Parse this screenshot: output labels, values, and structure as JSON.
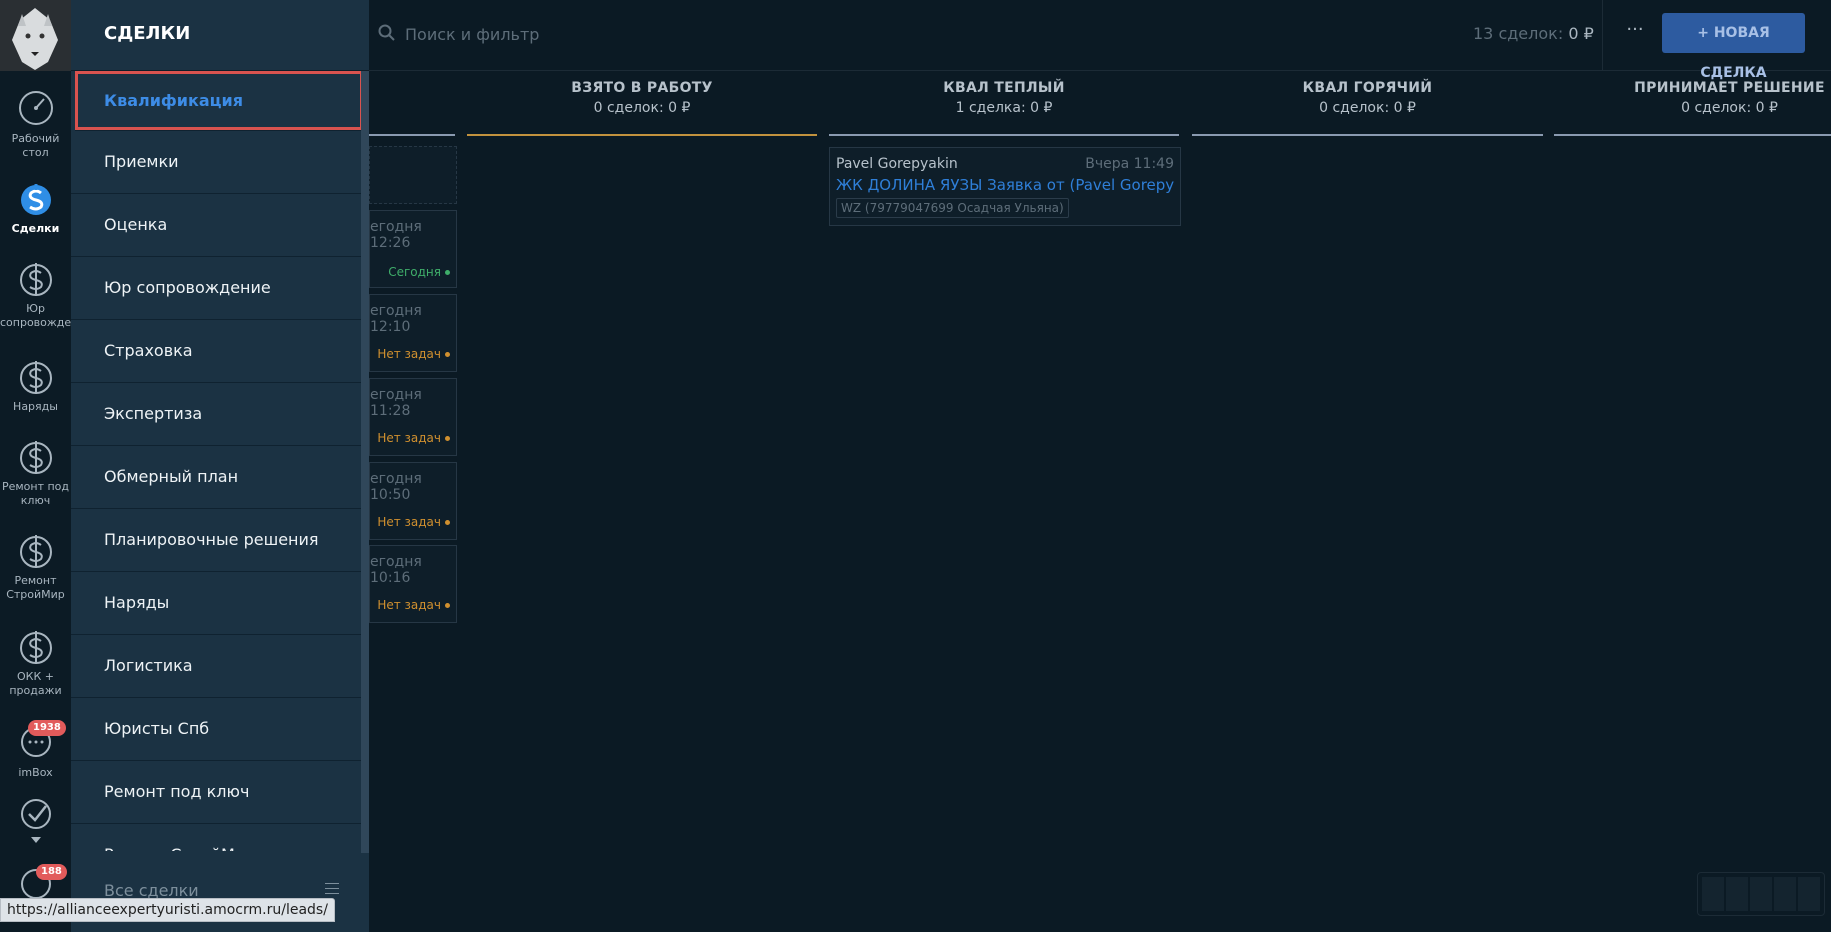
{
  "nav": {
    "items": [
      {
        "label": "Рабочий стол",
        "icon": "dashboard-gauge-icon"
      },
      {
        "label": "Сделки",
        "icon": "deals-dollar-icon"
      },
      {
        "label": "Юр сопровожде",
        "icon": "dollar-icon"
      },
      {
        "label": "Наряды",
        "icon": "dollar-icon"
      },
      {
        "label": "Ремонт под ключ",
        "icon": "dollar-icon"
      },
      {
        "label": "Ремонт СтройМир",
        "icon": "dollar-icon"
      },
      {
        "label": "ОКК + продажи",
        "icon": "dollar-icon"
      },
      {
        "label": "imBox",
        "icon": "chat-icon",
        "badge": "1938"
      },
      {
        "label": "",
        "icon": "checkmark-icon"
      }
    ],
    "bottom_badge": "188"
  },
  "pipelines": {
    "title": "СДЕЛКИ",
    "items": [
      "Квалификация",
      "Приемки",
      "Оценка",
      "Юр сопровождение",
      "Страховка",
      "Экспертиза",
      "Обмерный план",
      "Планировочные решения",
      "Наряды",
      "Логистика",
      "Юристы Спб",
      "Ремонт под ключ",
      "Ремонт СтройМир"
    ],
    "active_index": 0,
    "all_deals": "Все сделки"
  },
  "topbar": {
    "search_placeholder": "Поиск и фильтр",
    "count_label": "13 сделок:",
    "count_value": "0 ₽",
    "more": "···",
    "new_deal": "+ НОВАЯ СДЕЛКА"
  },
  "columns": [
    {
      "title": "ВЗЯТО В РАБОТУ",
      "count": "0 сделок: 0 ₽",
      "color": "#c2923e"
    },
    {
      "title": "КВАЛ ТЕПЛЫЙ",
      "count": "1 сделка: 0 ₽",
      "color": "#8a9ab0"
    },
    {
      "title": "КВАЛ ГОРЯЧИЙ",
      "count": "0 сделок: 0 ₽",
      "color": "#8a9ab0"
    },
    {
      "title": "ПРИНИМАЕТ РЕШЕНИЕ",
      "count": "0 сделок: 0 ₽",
      "color": "#8a9ab0"
    }
  ],
  "hidden_cards": [
    {
      "time": "егодня 12:26",
      "status": "Сегодня",
      "status_color": "#3fae6a"
    },
    {
      "time": "егодня 12:10",
      "status": "Нет задач",
      "status_color": "#d0902f"
    },
    {
      "time": "егодня 11:28",
      "status": "Нет задач",
      "status_color": "#d0902f"
    },
    {
      "time": "егодня 10:50",
      "status": "Нет задач",
      "status_color": "#d0902f"
    },
    {
      "time": "егодня 10:16",
      "status": "Нет задач",
      "status_color": "#d0902f"
    }
  ],
  "deal_card": {
    "contact": "Pavel Gorepyakin",
    "time": "Вчера 11:49",
    "title": "ЖК ДОЛИНА ЯУЗЫ Заявка от (Pavel Gorepya...",
    "tag": "WZ (79779047699 Осадчая Ульяна)"
  },
  "status_url": "https://allianceexpertyuristi.amocrm.ru/leads/"
}
